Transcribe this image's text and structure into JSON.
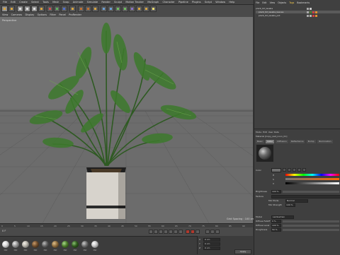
{
  "menubar": {
    "items": [
      "File",
      "Edit",
      "Create",
      "Select",
      "Tools",
      "Mesh",
      "Snap",
      "Animate",
      "Simulate",
      "Render",
      "Sculpt",
      "Motion Tracker",
      "MoGraph",
      "Character",
      "Pipeline",
      "Plugins",
      "Script",
      "Window",
      "Help"
    ]
  },
  "viewport": {
    "menu": [
      "View",
      "Cameras",
      "Display",
      "Options",
      "Filter",
      "Panel",
      "ProRender"
    ],
    "label": "Perspective",
    "grid_spacing": "Grid Spacing : 100 cm"
  },
  "timeline": {
    "ticks": [
      "0",
      "5",
      "10",
      "15",
      "20",
      "25",
      "30",
      "35",
      "40",
      "45",
      "50",
      "55",
      "60",
      "65",
      "70",
      "75",
      "80",
      "85",
      "90"
    ],
    "frame": "0 F"
  },
  "materials": {
    "items": [
      "Mat",
      "Mat",
      "Mat",
      "Mat",
      "Mat",
      "Mat",
      "Mat",
      "Mat",
      "Mat",
      "Mat"
    ],
    "colors": [
      "#d8d8d8",
      "#9a9a9a",
      "#b9b6ad",
      "#6d4c2c",
      "#5f5f5f",
      "#8a6a3d",
      "#4a7a2a",
      "#2f5a1e",
      "#6b6b6b",
      "#c9c9c9"
    ]
  },
  "coords": {
    "x": "0 cm",
    "y": "0 cm",
    "z": "0 cm",
    "apply": "Apply"
  },
  "object_manager": {
    "tabs": [
      "File",
      "Edit",
      "View",
      "Objects",
      "Tags",
      "Bookmarks"
    ],
    "active_tab": "Tags",
    "rows": [
      "plant_02_lasalia",
      "plant_02_lasalia_leaves",
      "plant_02_lasalia_pot"
    ]
  },
  "attributes": {
    "tabs": [
      "Basic",
      "Color",
      "Diffusion",
      "Reflectance",
      "Bump",
      "Illumination"
    ],
    "active_tab": "Color",
    "material_name": "Material [Copy_wet_noon_01]",
    "color_label": "Color",
    "brightness_label": "Brightness",
    "brightness_value": "100 %",
    "texture_label": "Texture",
    "mix_mode_label": "Mix Mode",
    "mix_mode_value": "Normal",
    "mix_strength_label": "Mix Strength",
    "mix_strength_value": "100 %",
    "model_label": "Model",
    "model_value": "Lambertian",
    "diffuse_falloff_label": "Diffuse Falloff",
    "diffuse_falloff_value": "0 %",
    "diffuse_level_label": "Diffuse Level",
    "diffuse_level_value": "100 %",
    "roughness_label": "Roughness",
    "roughness_value": "50 %"
  },
  "accent_colors": {
    "selected_tab": "#f2c94c",
    "record": "#b03a2e"
  }
}
